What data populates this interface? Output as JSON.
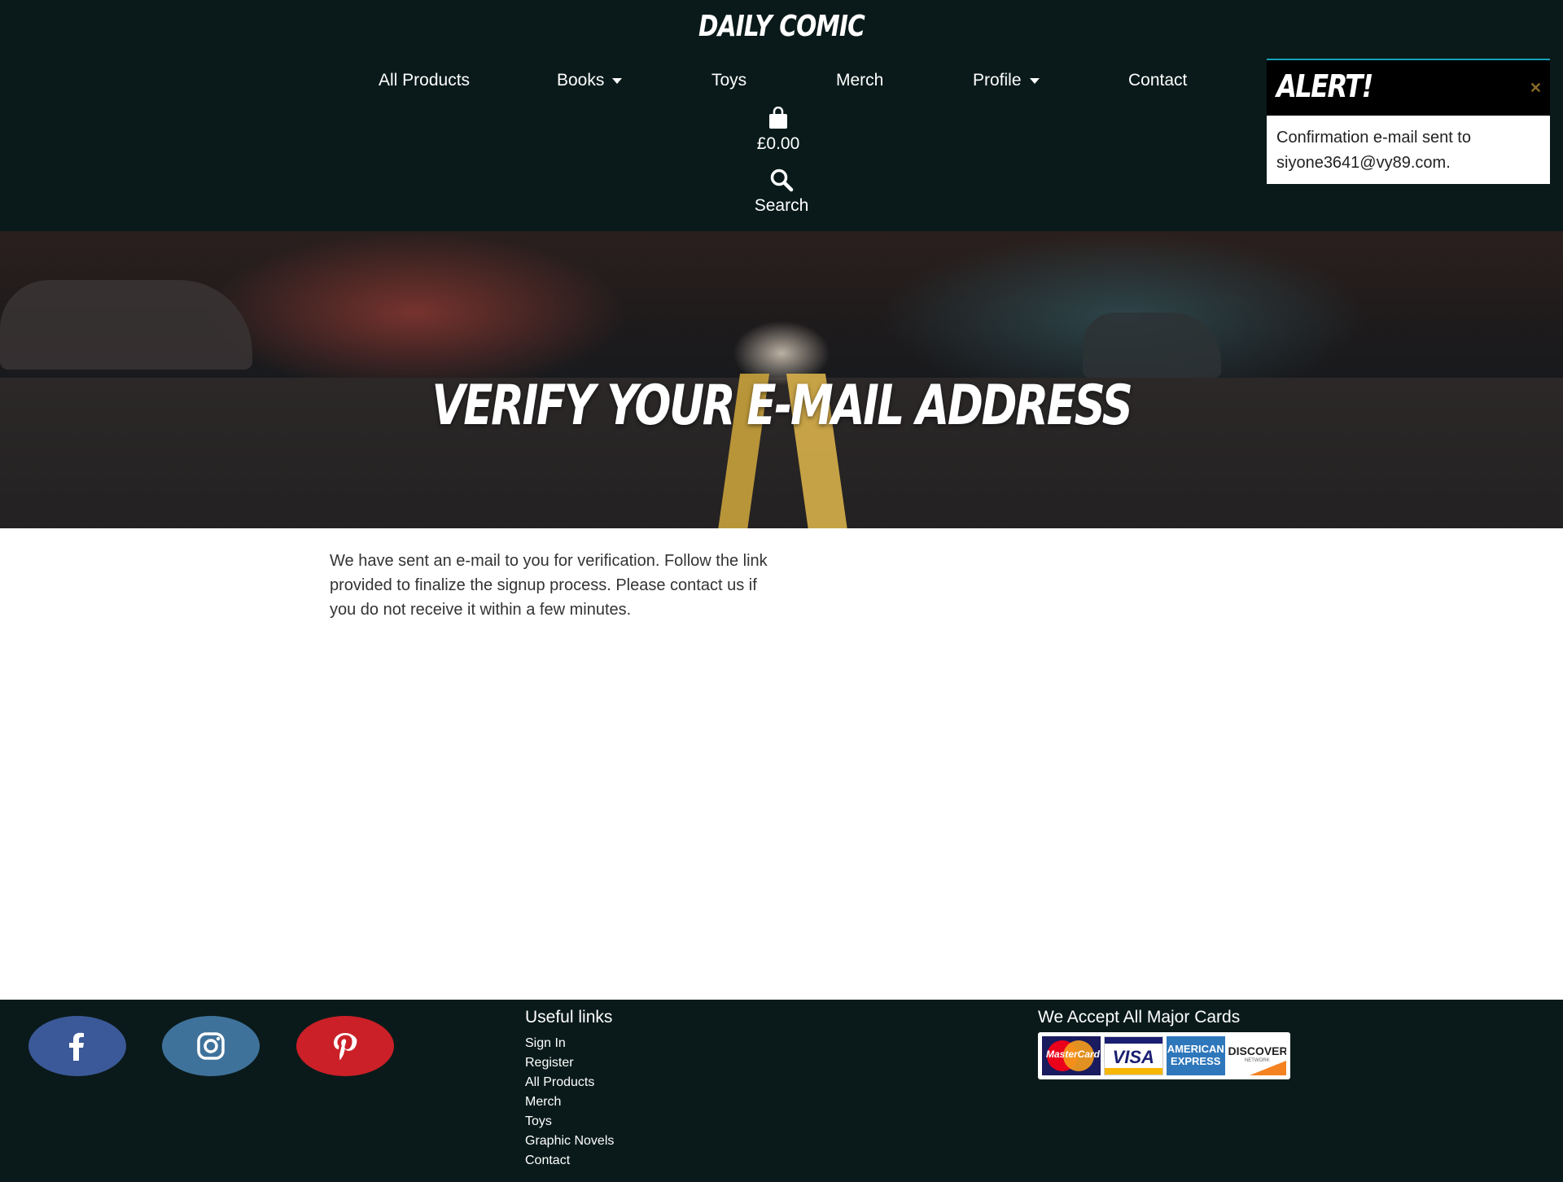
{
  "header": {
    "brand": "DAILY COMIC",
    "nav": [
      {
        "label": "All Products"
      },
      {
        "label": "Books",
        "dropdown": true
      },
      {
        "label": "Toys"
      },
      {
        "label": "Merch"
      },
      {
        "label": "Profile",
        "dropdown": true
      },
      {
        "label": "Contact"
      }
    ],
    "cart_total": "£0.00",
    "search_label": "Search"
  },
  "alert": {
    "title": "ALERT!",
    "message": "Confirmation e-mail sent to siyone3641@vy89.com."
  },
  "hero": {
    "title": "VERIFY YOUR E-MAIL ADDRESS"
  },
  "main": {
    "message": "We have sent an e-mail to you for verification. Follow the link provided to finalize the signup process. Please contact us if you do not receive it within a few minutes."
  },
  "footer": {
    "social": [
      "facebook-icon",
      "instagram-icon",
      "pinterest-icon"
    ],
    "colors": {
      "facebook": "#3b5998",
      "instagram": "#3f729b",
      "pinterest": "#cb2027"
    },
    "useful_links_title": "Useful links",
    "useful_links": [
      "Sign In",
      "Register",
      "All Products",
      "Merch",
      "Toys",
      "Graphic Novels",
      "Contact"
    ],
    "cards_title": "We Accept All Major Cards",
    "cards": [
      "MasterCard",
      "VISA",
      "AMERICAN EXPRESS",
      "DISCOVER",
      "NETWORK"
    ]
  },
  "colors": {
    "header_bg": "#0a1a1a",
    "alert_accent": "#17a2b8"
  }
}
